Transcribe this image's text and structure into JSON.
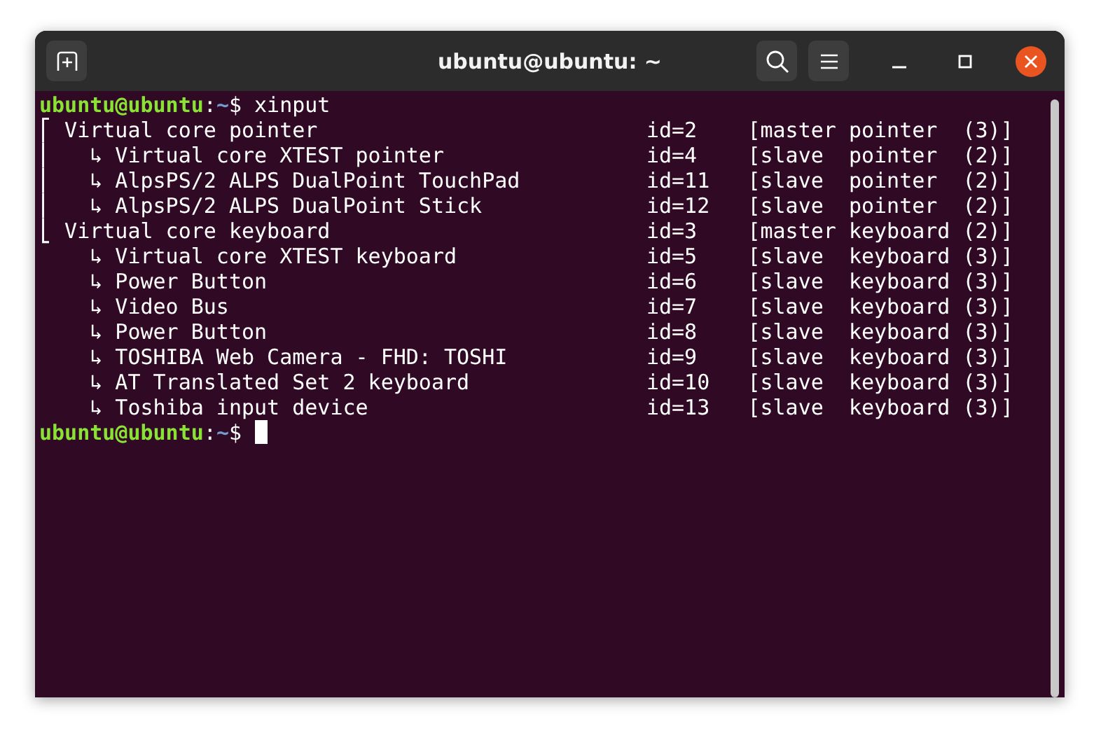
{
  "window": {
    "title": "ubuntu@ubuntu: ~"
  },
  "terminal": {
    "lines": [
      {
        "kind": "prompt",
        "user": "ubuntu@ubuntu",
        "separator": ":",
        "path": "~",
        "symbol": "$",
        "command": " xinput",
        "cursor": false
      },
      {
        "kind": "device",
        "device": "⎡ Virtual core pointer",
        "id": "id=2",
        "type": "[master pointer  (3)]"
      },
      {
        "kind": "device",
        "device": "⎜   ↳ Virtual core XTEST pointer",
        "id": "id=4",
        "type": "[slave  pointer  (2)]"
      },
      {
        "kind": "device",
        "device": "⎜   ↳ AlpsPS/2 ALPS DualPoint TouchPad",
        "id": "id=11",
        "type": "[slave  pointer  (2)]"
      },
      {
        "kind": "device",
        "device": "⎜   ↳ AlpsPS/2 ALPS DualPoint Stick",
        "id": "id=12",
        "type": "[slave  pointer  (2)]"
      },
      {
        "kind": "device",
        "device": "⎣ Virtual core keyboard",
        "id": "id=3",
        "type": "[master keyboard (2)]"
      },
      {
        "kind": "device",
        "device": "    ↳ Virtual core XTEST keyboard",
        "id": "id=5",
        "type": "[slave  keyboard (3)]"
      },
      {
        "kind": "device",
        "device": "    ↳ Power Button",
        "id": "id=6",
        "type": "[slave  keyboard (3)]"
      },
      {
        "kind": "device",
        "device": "    ↳ Video Bus",
        "id": "id=7",
        "type": "[slave  keyboard (3)]"
      },
      {
        "kind": "device",
        "device": "    ↳ Power Button",
        "id": "id=8",
        "type": "[slave  keyboard (3)]"
      },
      {
        "kind": "device",
        "device": "    ↳ TOSHIBA Web Camera - FHD: TOSHI",
        "id": "id=9",
        "type": "[slave  keyboard (3)]"
      },
      {
        "kind": "device",
        "device": "    ↳ AT Translated Set 2 keyboard",
        "id": "id=10",
        "type": "[slave  keyboard (3)]"
      },
      {
        "kind": "device",
        "device": "    ↳ Toshiba input device",
        "id": "id=13",
        "type": "[slave  keyboard (3)]"
      },
      {
        "kind": "prompt",
        "user": "ubuntu@ubuntu",
        "separator": ":",
        "path": "~",
        "symbol": "$",
        "cursor": true
      }
    ]
  }
}
